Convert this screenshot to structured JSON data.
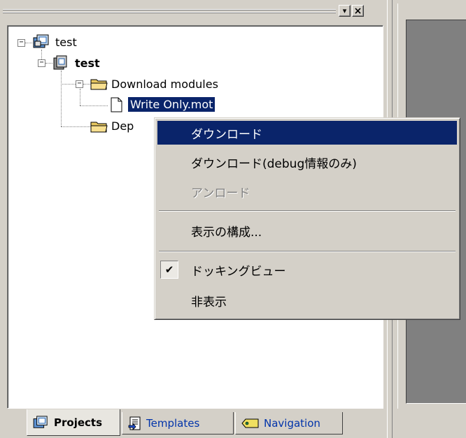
{
  "window": {
    "pin_glyph": "▾",
    "close_glyph": "×"
  },
  "tree": {
    "root": {
      "label": "test",
      "icon": "workspace-icon"
    },
    "project": {
      "label": "test",
      "icon": "project-icon"
    },
    "download_folder": {
      "label": "Download modules",
      "icon": "folder-icon"
    },
    "download_file": {
      "label": "Write Only.mot",
      "icon": "file-icon"
    },
    "dep_folder": {
      "label": "Dep",
      "icon": "folder-icon"
    }
  },
  "context_menu": {
    "items": [
      {
        "label": "ダウンロード",
        "state": "highlighted"
      },
      {
        "label": "ダウンロード(debug情報のみ)",
        "state": "normal"
      },
      {
        "label": "アンロード",
        "state": "disabled"
      },
      {
        "label": "表示の構成...",
        "state": "normal"
      },
      {
        "label": "ドッキングビュー",
        "state": "checked"
      },
      {
        "label": "非表示",
        "state": "normal"
      }
    ],
    "check_glyph": "✔"
  },
  "tabs": [
    {
      "label": "Projects",
      "active": true,
      "icon": "projects-icon"
    },
    {
      "label": "Templates",
      "active": false,
      "icon": "templates-icon"
    },
    {
      "label": "Navigation",
      "active": false,
      "icon": "navigation-icon"
    }
  ],
  "colors": {
    "highlight": "#0a246a",
    "face": "#d4d0c8",
    "dark_area": "#808080"
  }
}
